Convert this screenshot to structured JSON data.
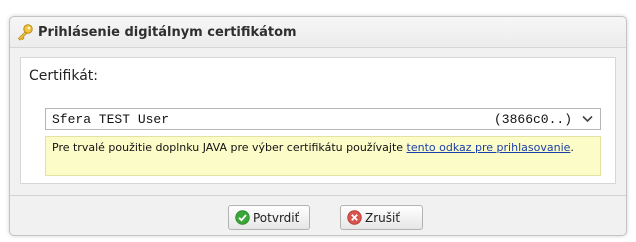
{
  "dialog": {
    "title": "Prihlásenie digitálnym certifikátom",
    "title_icon": "key-icon"
  },
  "form": {
    "certificate_label": "Certifikát:",
    "certificate_select": {
      "selected_name": "Sfera TEST User",
      "selected_id": "(3866c0..)"
    }
  },
  "notice": {
    "text": "Pre trvalé použitie doplnku JAVA pre výber certifikátu používajte ",
    "link_text": "tento odkaz pre prihlasovanie",
    "suffix": "."
  },
  "buttons": {
    "confirm_label": "Potvrdiť",
    "cancel_label": "Zrušiť",
    "confirm_icon": "check-icon",
    "cancel_icon": "cancel-icon"
  },
  "colors": {
    "notice_background": "#fcfcc9",
    "link": "#1b3fa8",
    "confirm_icon": "#3aa63a",
    "cancel_icon": "#d9534f"
  }
}
